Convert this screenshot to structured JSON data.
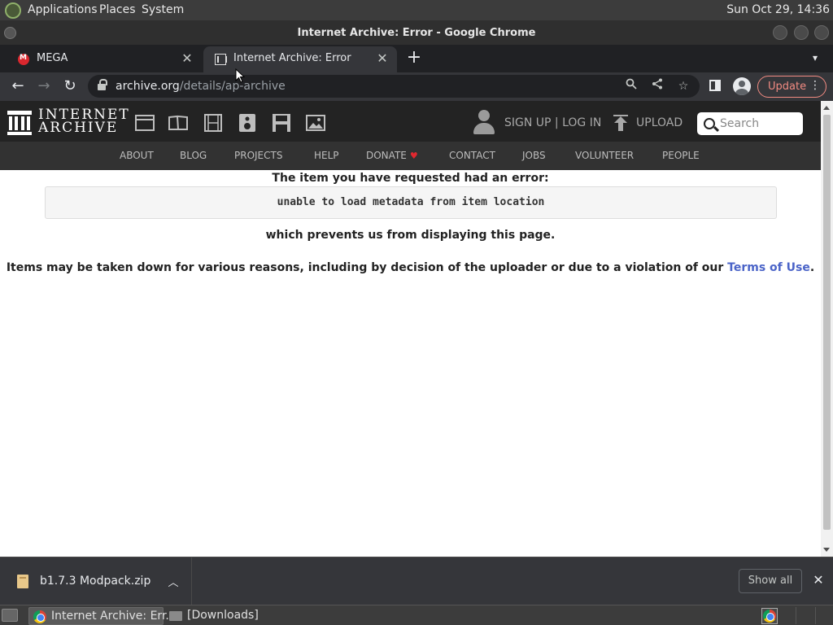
{
  "desktop": {
    "menus": [
      "Applications",
      "Places",
      "System"
    ],
    "clock": "Sun Oct 29, 14:36"
  },
  "window": {
    "title": "Internet Archive: Error - Google Chrome"
  },
  "tabs": [
    {
      "title": "MEGA",
      "icon": "mega-icon",
      "active": false
    },
    {
      "title": "Internet Archive: Error",
      "icon": "internet-archive-icon",
      "active": true
    }
  ],
  "toolbar": {
    "url_host": "archive.org",
    "url_path": "/details/ap-archive",
    "update_label": "Update"
  },
  "ia_header": {
    "wordmark_line1": "INTERNET",
    "wordmark_line2": "ARCHIVE",
    "media_icons": [
      "web-icon",
      "texts-icon",
      "video-icon",
      "audio-icon",
      "software-icon",
      "images-icon"
    ],
    "signin_label": "SIGN UP | LOG IN",
    "upload_label": "UPLOAD",
    "search_placeholder": "Search"
  },
  "ia_nav": {
    "items": [
      "ABOUT",
      "BLOG",
      "PROJECTS",
      "HELP",
      "DONATE",
      "CONTACT",
      "JOBS",
      "VOLUNTEER",
      "PEOPLE"
    ],
    "donate_heart_color": "#e0282f"
  },
  "error": {
    "heading": "The item you have requested had an error:",
    "message": "unable to load metadata from item location",
    "prevents": "which prevents us from displaying this page.",
    "reasons_text": "Items may be taken down for various reasons, including by decision of the uploader or due to a violation of our",
    "terms_link": "Terms of Use",
    "terms_after": "."
  },
  "downloads": {
    "file_name": "b1.7.3 Modpack.zip",
    "show_all_label": "Show all"
  },
  "taskbar": {
    "tasks": [
      {
        "label": "Internet Archive: Err...",
        "icon": "chrome-icon",
        "active": true
      },
      {
        "label": "[Downloads]",
        "icon": "folder-icon",
        "active": false
      }
    ]
  }
}
